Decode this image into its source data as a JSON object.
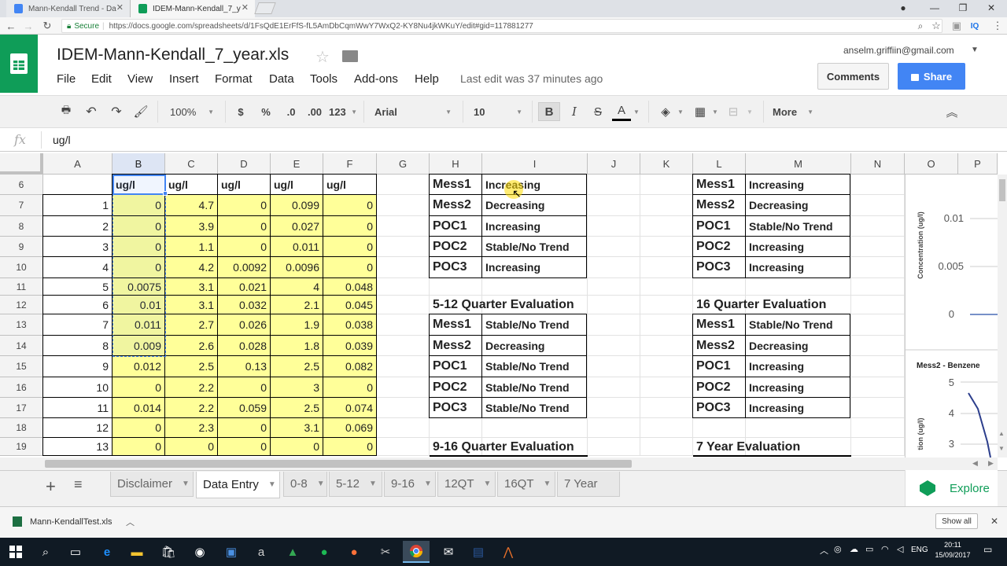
{
  "browser": {
    "tabs": [
      {
        "label": "Mann-Kendall Trend - Da",
        "color": "#4285f4"
      },
      {
        "label": "IDEM-Mann-Kendall_7_y",
        "color": "#0f9d58"
      }
    ],
    "secure_label": "Secure",
    "url": "https://docs.google.com/spreadsheets/d/1FsQdE1ErFfS-fL5AmDbCqmWwY7WxQ2-KY8Nu4jkWKuY/edit#gid=117881277"
  },
  "sheets": {
    "title": "IDEM-Mann-Kendall_7_year.xls",
    "menu": [
      "File",
      "Edit",
      "View",
      "Insert",
      "Format",
      "Data",
      "Tools",
      "Add-ons",
      "Help"
    ],
    "last_edit": "Last edit was 37 minutes ago",
    "account": "anselm.griffiin@gmail.com",
    "comments_label": "Comments",
    "share_label": "Share",
    "toolbar": {
      "zoom": "100%",
      "currency": "$",
      "percent": "%",
      "dec_less": ".0",
      "dec_more": ".00",
      "format": "123",
      "font": "Arial",
      "size": "10",
      "bold": "B",
      "italic": "I",
      "strike": "S",
      "text_color": "A",
      "more": "More"
    },
    "formula_value": "ug/l",
    "columns": [
      "A",
      "B",
      "C",
      "D",
      "E",
      "F",
      "G",
      "H",
      "I",
      "J",
      "K",
      "L",
      "M",
      "N",
      "O",
      "P"
    ],
    "row_numbers": [
      "6",
      "7",
      "8",
      "9",
      "10",
      "11",
      "12",
      "13",
      "14",
      "15",
      "16",
      "17",
      "18",
      "19"
    ],
    "unit_headers": [
      "ug/l",
      "ug/l",
      "ug/l",
      "ug/l",
      "ug/l"
    ],
    "data_rows": [
      [
        "1",
        "0",
        "4.7",
        "0",
        "0.099",
        "0"
      ],
      [
        "2",
        "0",
        "3.9",
        "0",
        "0.027",
        "0"
      ],
      [
        "3",
        "0",
        "1.1",
        "0",
        "0.011",
        "0"
      ],
      [
        "4",
        "0",
        "4.2",
        "0.0092",
        "0.0096",
        "0"
      ],
      [
        "5",
        "0.0075",
        "3.1",
        "0.021",
        "4",
        "0.048"
      ],
      [
        "6",
        "0.01",
        "3.1",
        "0.032",
        "2.1",
        "0.045"
      ],
      [
        "7",
        "0.011",
        "2.7",
        "0.026",
        "1.9",
        "0.038"
      ],
      [
        "8",
        "0.009",
        "2.6",
        "0.028",
        "1.8",
        "0.039"
      ],
      [
        "9",
        "0.012",
        "2.5",
        "0.13",
        "2.5",
        "0.082"
      ],
      [
        "10",
        "0",
        "2.2",
        "0",
        "3",
        "0"
      ],
      [
        "11",
        "0.014",
        "2.2",
        "0.059",
        "2.5",
        "0.074"
      ],
      [
        "12",
        "0",
        "2.3",
        "0",
        "3.1",
        "0.069"
      ],
      [
        "13",
        "0",
        "0",
        "0",
        "0",
        "0"
      ]
    ],
    "eval_tables": {
      "top_left": [
        [
          "Mess1",
          "Increasing"
        ],
        [
          "Mess2",
          "Decreasing"
        ],
        [
          "POC1",
          "Increasing"
        ],
        [
          "POC2",
          "Stable/No Trend"
        ],
        [
          "POC3",
          "Increasing"
        ]
      ],
      "top_right": [
        [
          "Mess1",
          "Increasing"
        ],
        [
          "Mess2",
          "Decreasing"
        ],
        [
          "POC1",
          "Stable/No Trend"
        ],
        [
          "POC2",
          "Increasing"
        ],
        [
          "POC3",
          "Increasing"
        ]
      ],
      "q5_12_title": "5-12 Quarter Evaluation",
      "q5_12": [
        [
          "Mess1",
          "Stable/No Trend"
        ],
        [
          "Mess2",
          "Decreasing"
        ],
        [
          "POC1",
          "Stable/No Trend"
        ],
        [
          "POC2",
          "Stable/No Trend"
        ],
        [
          "POC3",
          "Stable/No Trend"
        ]
      ],
      "q16_title": "16 Quarter Evaluation",
      "q16": [
        [
          "Mess1",
          "Stable/No Trend"
        ],
        [
          "Mess2",
          "Decreasing"
        ],
        [
          "POC1",
          "Increasing"
        ],
        [
          "POC2",
          "Increasing"
        ],
        [
          "POC3",
          "Increasing"
        ]
      ],
      "q9_16_title": "9-16 Quarter Evaluation",
      "y7_title": "7 Year Evaluation"
    },
    "chart1": {
      "ylabel": "Concentration (ug/l)",
      "ticks": [
        "0.01",
        "0.005",
        "0"
      ]
    },
    "chart2": {
      "title": "Mess2 - Benzene",
      "ylabel": "tion (ug/l)",
      "ticks": [
        "5",
        "4",
        "3"
      ]
    },
    "sheet_tabs": [
      "Disclaimer",
      "Data Entry",
      "0-8",
      "5-12",
      "9-16",
      "12QT",
      "16QT",
      "7 Year"
    ],
    "active_tab": "Data Entry",
    "explore_label": "Explore"
  },
  "downloads": {
    "file": "Mann-KendallTest.xls",
    "show_all": "Show all"
  },
  "taskbar": {
    "lang": "ENG",
    "time": "20:11",
    "date": "15/09/2017"
  }
}
